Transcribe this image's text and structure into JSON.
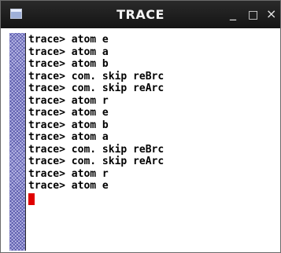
{
  "window": {
    "title": "TRACE",
    "controls": {
      "minimize": "_",
      "maximize": "□",
      "close": "×"
    }
  },
  "terminal": {
    "lines": [
      "trace> atom e",
      "trace> atom a",
      "trace> atom b",
      "trace> com. skip reBrc",
      "trace> com. skip reArc",
      "trace> atom r",
      "trace> atom e",
      "trace> atom b",
      "trace> atom a",
      "trace> com. skip reBrc",
      "trace> com. skip reArc",
      "trace> atom r",
      "trace> atom e"
    ],
    "cursor_color": "#e00000"
  },
  "colors": {
    "titlebar": "#1c1c1c",
    "terminal_bg": "#ffffff",
    "scrollbar": "#b8b8e6"
  }
}
